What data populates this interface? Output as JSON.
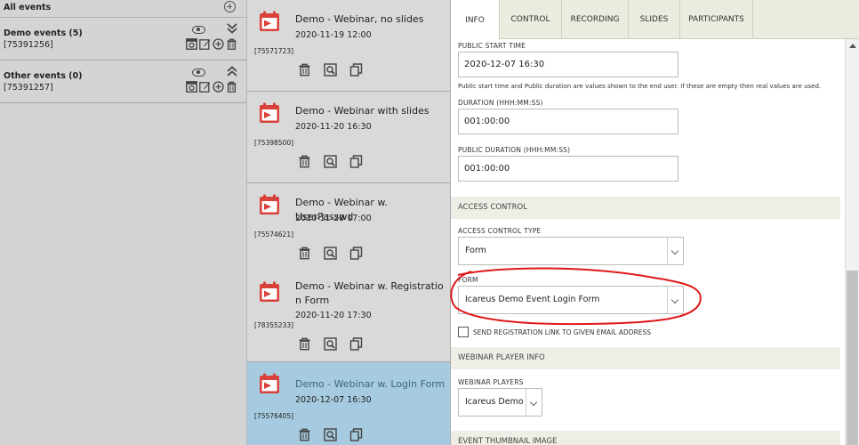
{
  "sidebar": {
    "header_label": "All events",
    "groups": [
      {
        "name": "Demo events (5)",
        "id": "[75391256]",
        "expanded": true
      },
      {
        "name": "Other events (0)",
        "id": "[75391257]",
        "expanded": false
      }
    ]
  },
  "events": [
    {
      "title": "Demo - Webinar, no slides",
      "date": "2020-11-19 12:00",
      "id": "[75571723]"
    },
    {
      "title": "Demo - Webinar with slides",
      "date": "2020-11-20 16:30",
      "id": "[75398500]"
    },
    {
      "title": "Demo - Webinar w. UserPasswd",
      "date": "2020-11-20 17:00",
      "id": "[75574621]"
    },
    {
      "title": "Demo - Webinar w. Registration Form",
      "date": "2020-11-20 17:30",
      "id": "[78355233]"
    },
    {
      "title": "Demo - Webinar w. Login Form",
      "date": "2020-12-07 16:30",
      "id": "[75576405]",
      "selected": true
    }
  ],
  "tabs": [
    "Info",
    "Control",
    "Recording",
    "Slides",
    "Participants"
  ],
  "active_tab": "Info",
  "form": {
    "public_start_time_label": "Public start time",
    "public_start_time_value": "2020-12-07 16:30",
    "hint": "Public start time and Public duration are values shown to the end user. If these are empty then real values are used.",
    "duration_label": "Duration (HHH:MM:SS)",
    "duration_value": "001:00:00",
    "public_duration_label": "Public duration (HHH:MM:SS)",
    "public_duration_value": "001:00:00",
    "access_control_section": "Access control",
    "access_control_type_label": "Access control type",
    "access_control_type_value": "Form",
    "form_label": "Form",
    "form_value": "Icareus Demo Event Login Form",
    "send_link_label": "Send registration link to given email address",
    "webinar_player_section": "Webinar player info",
    "webinar_players_label": "Webinar players",
    "webinar_players_value": "Icareus Demo Webinar Player",
    "thumbnail_section": "Event thumbnail image"
  },
  "colors": {
    "sidebar_bg": "#d4d4d4",
    "card_bg": "#d9d9d9",
    "card_selected_bg": "#a6cbe0",
    "calendar_red": "#d9413b",
    "tab_bar_bg": "#ecebdf",
    "section_bg": "#efeee6",
    "annotation_red": "#e01818"
  }
}
